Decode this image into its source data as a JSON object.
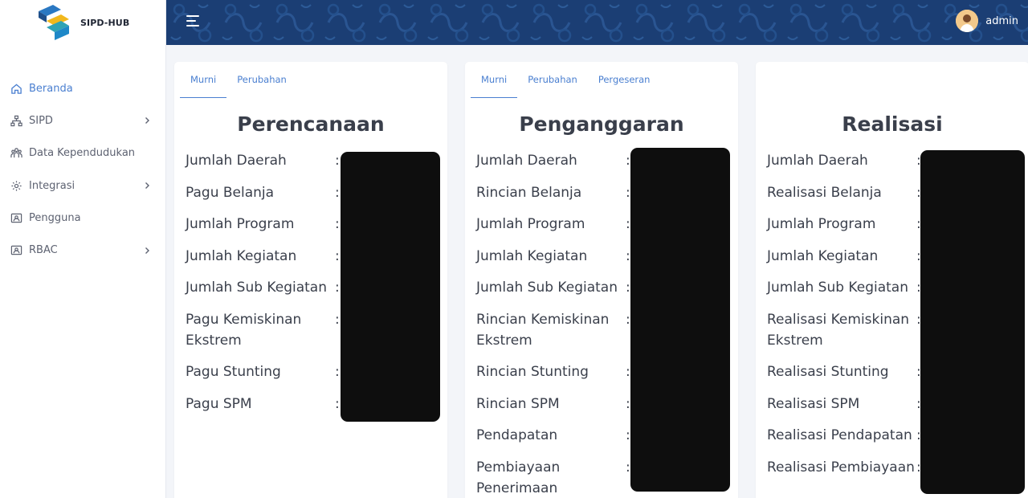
{
  "brand": {
    "name": "SIPD-HUB"
  },
  "sidebar": {
    "items": [
      {
        "label": "Beranda",
        "icon": "home-icon",
        "active": true
      },
      {
        "label": "SIPD",
        "icon": "sitemap-icon",
        "has_children": true
      },
      {
        "label": "Data Kependudukan",
        "icon": "users-icon"
      },
      {
        "label": "Integrasi",
        "icon": "gear-icon",
        "has_children": true
      },
      {
        "label": "Pengguna",
        "icon": "id-card-icon"
      },
      {
        "label": "RBAC",
        "icon": "id-card-icon",
        "has_children": true
      }
    ]
  },
  "topbar": {
    "username": "admin"
  },
  "cards": [
    {
      "tabs": [
        "Murni",
        "Perubahan"
      ],
      "active_tab": "Murni",
      "title": "Perencanaan",
      "rows": [
        "Jumlah Daerah",
        "Pagu Belanja",
        "Jumlah Program",
        "Jumlah Kegiatan",
        "Jumlah Sub Kegiatan",
        "Pagu Kemiskinan Ekstrem",
        "Pagu Stunting",
        "Pagu SPM"
      ]
    },
    {
      "tabs": [
        "Murni",
        "Perubahan",
        "Pergeseran"
      ],
      "active_tab": "Murni",
      "title": "Penganggaran",
      "rows": [
        "Jumlah Daerah",
        "Rincian Belanja",
        "Jumlah Program",
        "Jumlah Kegiatan",
        "Jumlah Sub Kegiatan",
        "Rincian Kemiskinan Ekstrem",
        "Rincian Stunting",
        "Rincian SPM",
        "Pendapatan",
        "Pembiayaan Penerimaan"
      ]
    },
    {
      "tabs": [],
      "title": "Realisasi",
      "rows": [
        "Jumlah Daerah",
        "Realisasi Belanja",
        "Jumlah Program",
        "Jumlah Kegiatan",
        "Jumlah Sub Kegiatan",
        "Realisasi Kemiskinan Ekstrem",
        "Realisasi Stunting",
        "Realisasi SPM",
        "Realisasi Pendapatan",
        "Realisasi Pembiayaan"
      ]
    }
  ],
  "row_separator": ":",
  "colors": {
    "topbar": "#1b3e74",
    "accent": "#4a7fd0",
    "redaction": "#0e0e0e"
  }
}
